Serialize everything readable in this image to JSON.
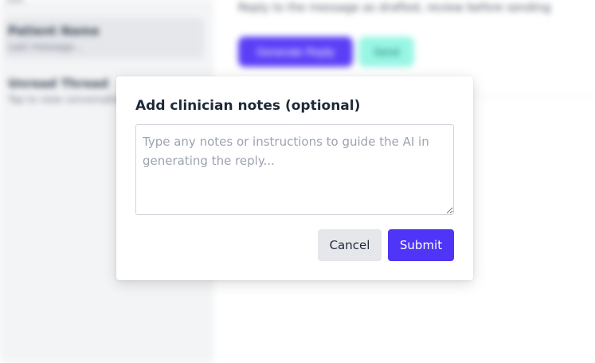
{
  "colors": {
    "accent": "#4f35f5",
    "cancel_bg": "#e5e7eb",
    "sidebar_bg": "#f3f4f6"
  },
  "background": {
    "sidebar": {
      "threads": [
        {
          "name": "Patient Name",
          "preview": "Last message..."
        },
        {
          "name": "Unread Thread",
          "preview": "Tap to view conversation"
        }
      ]
    },
    "main": {
      "message_snippet": "Reply to the message as drafted, review before sending",
      "buttons": {
        "primary": "Generate Reply",
        "secondary": "Send"
      }
    }
  },
  "modal": {
    "title": "Add clinician notes (optional)",
    "notes": {
      "value": "",
      "placeholder": "Type any notes or instructions to guide the AI in generating the reply..."
    },
    "cancel_label": "Cancel",
    "submit_label": "Submit"
  }
}
